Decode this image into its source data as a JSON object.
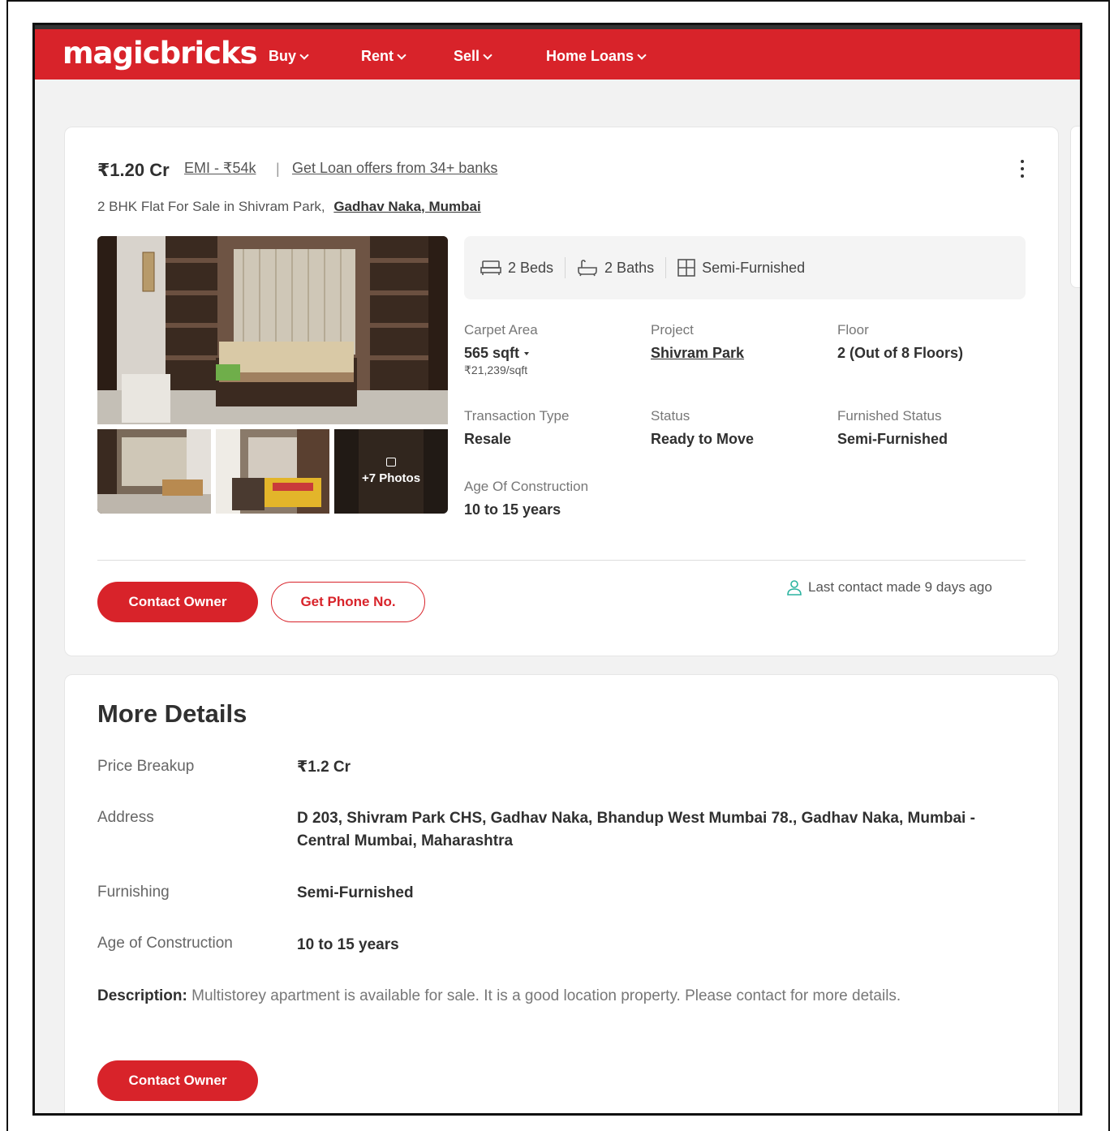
{
  "nav": {
    "logo": "magicbricks",
    "items": [
      {
        "label": "Buy"
      },
      {
        "label": "Rent"
      },
      {
        "label": "Sell"
      },
      {
        "label": "Home Loans"
      }
    ]
  },
  "listing": {
    "price": "₹1.20 Cr",
    "emi": "EMI - ₹54k",
    "separator": "|",
    "loan_offer": "Get Loan offers from 34+ banks",
    "title_prefix": "2 BHK Flat For Sale in Shivram Park,",
    "title_location": "Gadhav Naka, Mumbai",
    "photos_more": "+7 Photos",
    "features": [
      {
        "icon": "bed-icon",
        "label": "2 Beds"
      },
      {
        "icon": "bath-icon",
        "label": "2 Baths"
      },
      {
        "icon": "furnished-icon",
        "label": "Semi-Furnished"
      }
    ],
    "specs": {
      "carpet_area": {
        "label": "Carpet Area",
        "value": "565 sqft",
        "sub": "₹21,239/sqft"
      },
      "project": {
        "label": "Project",
        "value": "Shivram Park"
      },
      "floor": {
        "label": "Floor",
        "value": "2 (Out of 8 Floors)"
      },
      "transaction": {
        "label": "Transaction Type",
        "value": "Resale"
      },
      "status": {
        "label": "Status",
        "value": "Ready to Move"
      },
      "furnished": {
        "label": "Furnished Status",
        "value": "Semi-Furnished"
      },
      "age": {
        "label": "Age Of Construction",
        "value": "10 to 15 years"
      }
    },
    "contact_owner_label": "Contact Owner",
    "get_phone_label": "Get Phone No.",
    "last_contact": "Last contact made 9 days ago"
  },
  "more_details": {
    "title": "More Details",
    "rows": [
      {
        "label": "Price Breakup",
        "value": "₹1.2 Cr"
      },
      {
        "label": "Address",
        "value": "D 203, Shivram Park CHS, Gadhav Naka, Bhandup West Mumbai 78., Gadhav Naka, Mumbai - Central Mumbai, Maharashtra"
      },
      {
        "label": "Furnishing",
        "value": "Semi-Furnished"
      },
      {
        "label": "Age of Construction",
        "value": "10 to 15 years"
      }
    ],
    "description_label": "Description:",
    "description_text": "Multistorey apartment is available for sale. It is a good location property. Please contact for more details.",
    "contact_owner_label": "Contact Owner"
  },
  "colors": {
    "brand_red": "#d8232a",
    "text_dark": "#303030",
    "text_muted": "#777777"
  }
}
